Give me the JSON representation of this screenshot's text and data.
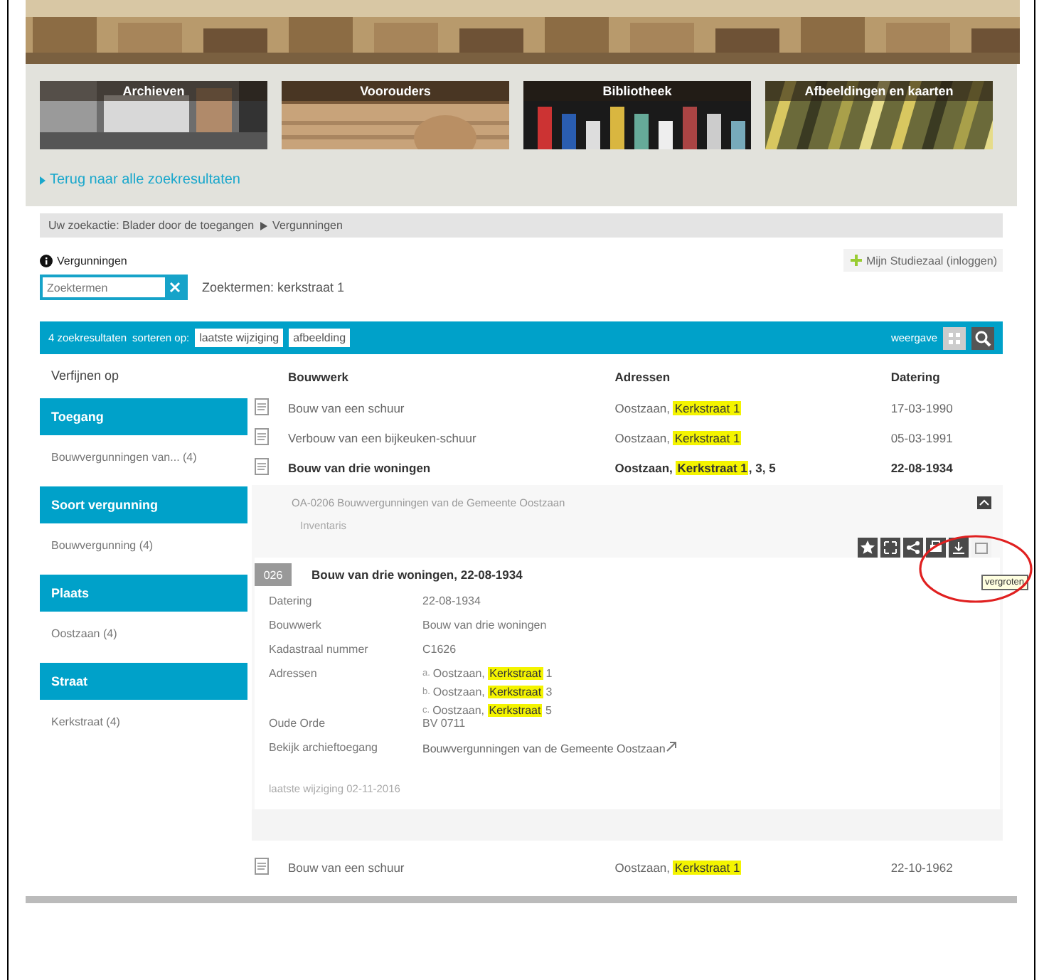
{
  "tiles": [
    {
      "label": "Archieven"
    },
    {
      "label": "Voorouders"
    },
    {
      "label": "Bibliotheek"
    },
    {
      "label": "Afbeeldingen en kaarten"
    }
  ],
  "back_link": "Terug naar alle zoekresultaten",
  "breadcrumb": {
    "prefix": "Uw zoekactie: Blader door de toegangen",
    "current": "Vergunningen"
  },
  "section_title": "Vergunningen",
  "login_button": "Mijn Studiezaal (inloggen)",
  "search": {
    "placeholder": "Zoektermen"
  },
  "search_summary": "Zoektermen: kerkstraat 1",
  "results_bar": {
    "count": "4 zoekresultaten",
    "sort_label": "sorteren op:",
    "sort_options": [
      "laatste wijziging",
      "afbeelding"
    ],
    "view_label": "weergave"
  },
  "filters": {
    "title": "Verfijnen op",
    "groups": [
      {
        "heading": "Toegang",
        "items": [
          "Bouwvergunningen van... (4)"
        ]
      },
      {
        "heading": "Soort vergunning",
        "items": [
          "Bouwvergunning (4)"
        ]
      },
      {
        "heading": "Plaats",
        "items": [
          "Oostzaan (4)"
        ]
      },
      {
        "heading": "Straat",
        "items": [
          "Kerkstraat (4)"
        ]
      }
    ]
  },
  "table": {
    "columns": [
      "Bouwwerk",
      "Adressen",
      "Datering"
    ],
    "rows": [
      {
        "bouwwerk": "Bouw van een schuur",
        "address": {
          "place": "Oostzaan, ",
          "highlight": "Kerkstraat 1"
        },
        "datering": "17-03-1990",
        "expanded": false
      },
      {
        "bouwwerk": "Verbouw van een bijkeuken-schuur",
        "address": {
          "place": "Oostzaan, ",
          "highlight": "Kerkstraat 1"
        },
        "datering": "05-03-1991",
        "expanded": false
      },
      {
        "bouwwerk": "Bouw van drie woningen",
        "address": {
          "place": "Oostzaan, ",
          "highlight": "Kerkstraat 1",
          "rest": ", 3, 5"
        },
        "datering": "22-08-1934",
        "expanded": true
      },
      {
        "bouwwerk": "Bouw van een schuur",
        "address": {
          "place": "Oostzaan, ",
          "highlight": "Kerkstraat 1"
        },
        "datering": "22-10-1962",
        "expanded": false
      }
    ]
  },
  "detail": {
    "archive": "OA-0206 Bouwvergunningen van de Gemeente Oostzaan",
    "sublabel": "Inventaris",
    "tooltip": "vergroten",
    "thumbnail": "026",
    "title": "Bouw van drie woningen, 22-08-1934",
    "fields": [
      {
        "kind": "text",
        "label": "Datering",
        "value": "22-08-1934"
      },
      {
        "kind": "text",
        "label": "Bouwwerk",
        "value": "Bouw van drie woningen"
      },
      {
        "kind": "text",
        "label": "Kadastraal nummer",
        "value": "C1626"
      },
      {
        "kind": "addresses",
        "label": "Adressen",
        "addresses": [
          {
            "marker": "a.",
            "place": "Oostzaan, ",
            "highlight": "Kerkstraat",
            "rest": " 1"
          },
          {
            "marker": "b.",
            "place": "Oostzaan, ",
            "highlight": "Kerkstraat",
            "rest": " 3"
          },
          {
            "marker": "c.",
            "place": "Oostzaan, ",
            "highlight": "Kerkstraat",
            "rest": " 5"
          }
        ]
      },
      {
        "kind": "text",
        "label": "Oude Orde",
        "value": "BV 0711"
      },
      {
        "kind": "link",
        "label": "Bekijk archieftoegang",
        "value": "Bouwvergunningen van de Gemeente Oostzaan"
      }
    ],
    "footer": "laatste wijziging 02-11-2016"
  }
}
